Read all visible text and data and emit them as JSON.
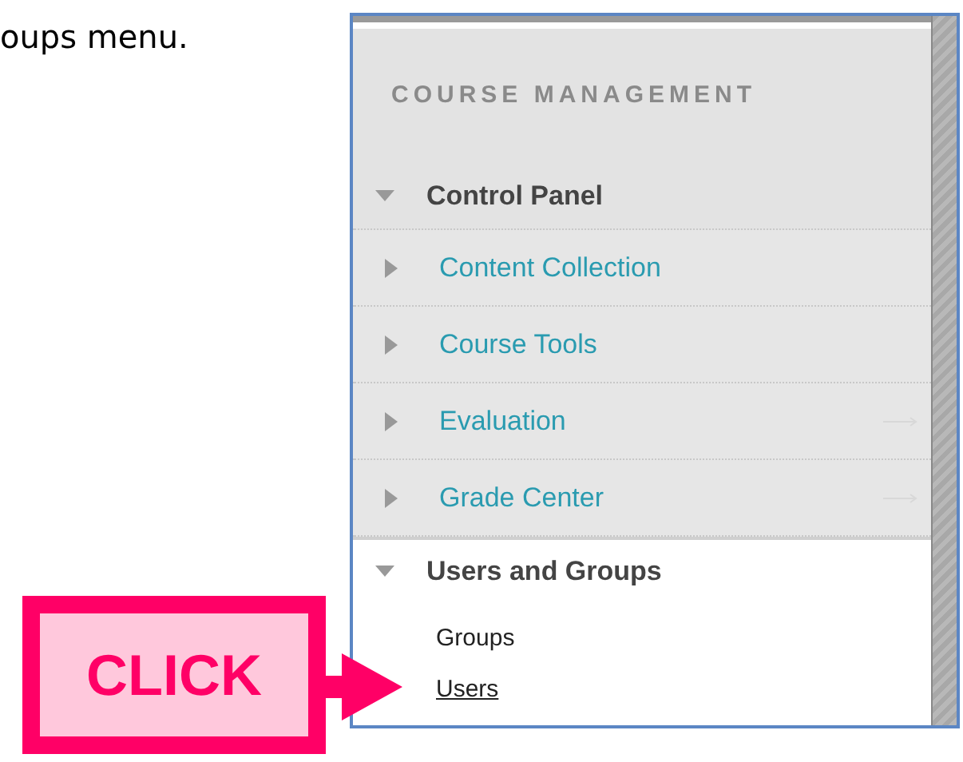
{
  "caption": "oups menu.",
  "panel": {
    "heading": "COURSE MANAGEMENT",
    "menu": [
      {
        "label": "Control Panel",
        "expanded": true,
        "children": [
          {
            "kind": "section",
            "label": "Content Collection",
            "expanded": false,
            "arrow": false
          },
          {
            "kind": "section",
            "label": "Course Tools",
            "expanded": false,
            "arrow": false
          },
          {
            "kind": "section",
            "label": "Evaluation",
            "expanded": false,
            "arrow": true
          },
          {
            "kind": "section",
            "label": "Grade Center",
            "expanded": false,
            "arrow": true
          }
        ]
      },
      {
        "label": "Users and Groups",
        "expanded": true,
        "children": [
          {
            "kind": "link",
            "label": "Groups",
            "selected": false
          },
          {
            "kind": "link",
            "label": "Users",
            "selected": true
          }
        ]
      }
    ]
  },
  "callout": {
    "label": "CLICK"
  }
}
